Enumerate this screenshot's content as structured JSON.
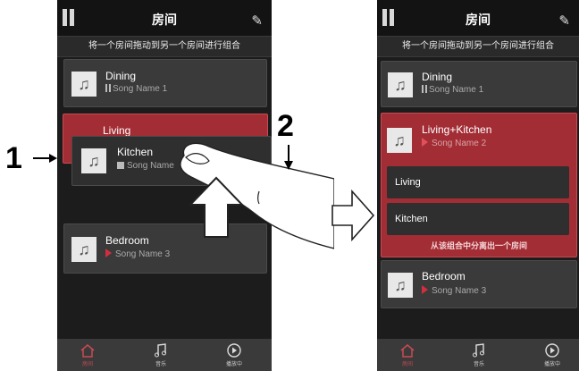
{
  "header": {
    "title": "房间"
  },
  "subtitle": "将一个房间拖动到另一个房间进行组合",
  "left": {
    "dining": {
      "name": "Dining",
      "song": "Song Name 1"
    },
    "living": {
      "name": "Living"
    },
    "kitchen": {
      "name": "Kitchen",
      "song": "Song Name"
    },
    "bedroom": {
      "name": "Bedroom",
      "song": "Song Name 3"
    }
  },
  "right": {
    "dining": {
      "name": "Dining",
      "song": "Song Name 1"
    },
    "group": {
      "name": "Living+Kitchen",
      "song": "Song Name 2"
    },
    "living": "Living",
    "kitchen": "Kitchen",
    "separate_text": "从该组合中分离出一个房间",
    "bedroom": {
      "name": "Bedroom",
      "song": "Song Name 3"
    }
  },
  "nav": {
    "rooms": "房间",
    "music": "音乐",
    "now_playing": "播放中"
  },
  "annotations": {
    "step1": "1",
    "step2": "2"
  },
  "icons": [
    "pause-icon",
    "pencil-icon",
    "music-note-icon",
    "play-icon",
    "home-icon",
    "hand-icon",
    "arrow-right-icon",
    "arrow-up-icon"
  ],
  "colors": {
    "accent": "#a32d35",
    "play": "#d22e3e",
    "nav_active": "#c84a55"
  }
}
